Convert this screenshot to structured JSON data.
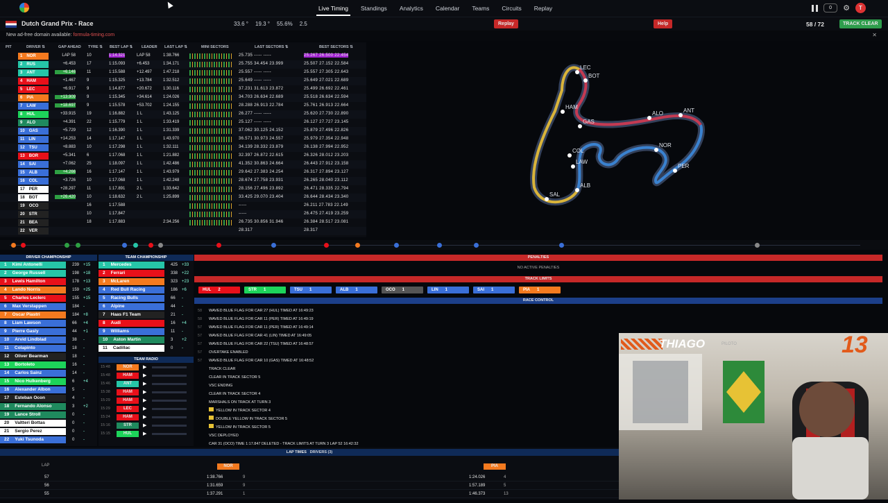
{
  "nav": {
    "items": [
      "Live Timing",
      "Standings",
      "Analytics",
      "Calendar",
      "Teams",
      "Circuits",
      "Replay"
    ],
    "active": "Live Timing",
    "notif_count": "0",
    "avatar": "T"
  },
  "race": {
    "title": "Dutch Grand Prix - Race",
    "air_temp": "33.6 °",
    "track_temp": "19.3 °",
    "humidity": "55.6%",
    "wind": "2.5",
    "replay_label": "Replay",
    "help_label": "Help",
    "lap": "58 / 72",
    "status": "TRACK CLEAR"
  },
  "ad": {
    "text": "New ad-free domain available:",
    "link": "formula-timing.com"
  },
  "timing": {
    "headers": [
      "PIT",
      "DRIVER ⇅",
      "GAP AHEAD",
      "TYRE ⇅",
      "BEST LAP ⇅",
      "LEADER",
      "LAST LAP ⇅",
      "MINI SECTORS",
      "LAST SECTORS ⇅",
      "BEST SECTORS ⇅"
    ],
    "rows": [
      {
        "p": "1",
        "d": "NOR",
        "c": "#f47a1f",
        "gap": "LAP 58",
        "ty": "10",
        "best": "1:14.321",
        "lead": "LAP 58",
        "last": "1:38.766",
        "ls": "25.735 ----- -----",
        "bs": "25.267 26.500 22.454"
      },
      {
        "p": "2",
        "d": "RUS",
        "c": "#26c6a8",
        "gap": "+6.453",
        "ty": "17",
        "best": "1:15.093",
        "lead": "+6.453",
        "last": "1:34.171",
        "ls": "25.755 34.454 23.999",
        "bs": "25.507 27.152 22.584"
      },
      {
        "p": "3",
        "d": "ANT",
        "c": "#26c6a8",
        "gap": "+6.146",
        "ty": "11",
        "best": "1:15.588",
        "lead": "+12.497",
        "last": "1:47.218",
        "ls": "25.557 ----- -----",
        "bs": "25.557 27.305 22.643"
      },
      {
        "p": "4",
        "d": "HAM",
        "c": "#e8101a",
        "gap": "+1.467",
        "ty": "9",
        "best": "1:15.325",
        "lead": "+13.784",
        "last": "1:32.512",
        "ls": "25.649 ----- -----",
        "bs": "25.649 27.021 22.689"
      },
      {
        "p": "5",
        "d": "LEC",
        "c": "#e8101a",
        "gap": "+6.917",
        "ty": "9",
        "best": "1:14.877",
        "lead": "+20.672",
        "last": "1:30.116",
        "ls": "37.231 31.613 23.872",
        "bs": "25.499 26.692 22.461"
      },
      {
        "p": "6",
        "d": "PIA",
        "c": "#f47a1f",
        "gap": "+13.909",
        "ty": "9",
        "best": "1:15.345",
        "lead": "+34.614",
        "last": "1:24.026",
        "ls": "34.703 26.634 22.689",
        "bs": "25.518 26.634 22.594"
      },
      {
        "p": "7",
        "d": "LAW",
        "c": "#3a6fd8",
        "gap": "+18.697",
        "ty": "9",
        "best": "1:15.578",
        "lead": "+53.702",
        "last": "1:24.155",
        "ls": "28.288 26.913 22.784",
        "bs": "25.761 26.913 22.664"
      },
      {
        "p": "8",
        "d": "HUL",
        "c": "#1dd45a",
        "gap": "+33.915",
        "ty": "19",
        "best": "1:16.882",
        "lead": "1 L",
        "last": "1:43.125",
        "ls": "26.277 ----- -----",
        "bs": "25.620 27.730 22.890"
      },
      {
        "p": "9",
        "d": "ALO",
        "c": "#1f8a5e",
        "gap": "+4.391",
        "ty": "22",
        "best": "1:15.779",
        "lead": "1 L",
        "last": "1:33.419",
        "ls": "25.127 ----- -----",
        "bs": "26.127 27.727 23.145"
      },
      {
        "p": "10",
        "d": "GAS",
        "c": "#3a6fd8",
        "gap": "+5.729",
        "ty": "12",
        "best": "1:16.390",
        "lead": "1 L",
        "last": "1:31.339",
        "ls": "37.062 30.125 24.152",
        "bs": "25.879 27.496 22.826"
      },
      {
        "p": "11",
        "d": "LIN",
        "c": "#3a6fd8",
        "gap": "+14.253",
        "ty": "14",
        "best": "1:17.147",
        "lead": "1 L",
        "last": "1:43.970",
        "ls": "36.571 30.973 24.557",
        "bs": "25.979 27.354 22.948"
      },
      {
        "p": "12",
        "d": "TSU",
        "c": "#3a6fd8",
        "gap": "+8.883",
        "ty": "10",
        "best": "1:17.298",
        "lead": "1 L",
        "last": "1:32.111",
        "ls": "34.139 28.332 23.879",
        "bs": "26.138 27.994 22.952"
      },
      {
        "p": "13",
        "d": "BOR",
        "c": "#e8101a",
        "gap": "+5.341",
        "ty": "6",
        "best": "1:17.068",
        "lead": "1 L",
        "last": "1:21.882",
        "ls": "32.397 26.872 22.615",
        "bs": "26.326 28.012 23.203"
      },
      {
        "p": "14",
        "d": "SAI",
        "c": "#3a6fd8",
        "gap": "+7.062",
        "ty": "25",
        "best": "1:18.097",
        "lead": "1 L",
        "last": "1:42.486",
        "ls": "41.352 30.863 24.664",
        "bs": "26.443 27.912 23.158"
      },
      {
        "p": "15",
        "d": "ALB",
        "c": "#3a6fd8",
        "gap": "+4.266",
        "ty": "16",
        "best": "1:17.147",
        "lead": "1 L",
        "last": "1:43.979",
        "ls": "29.642 27.383 24.254",
        "bs": "26.317 27.894 23.127"
      },
      {
        "p": "16",
        "d": "COL",
        "c": "#3a6fd8",
        "gap": "+3.726",
        "ty": "10",
        "best": "1:17.068",
        "lead": "1 L",
        "last": "1:42.248",
        "ls": "28.674 27.758 23.931",
        "bs": "26.265 28.040 23.112"
      },
      {
        "p": "17",
        "d": "PER",
        "c": "#ffffff",
        "gap": "+28.297",
        "ty": "11",
        "best": "1:17.891",
        "lead": "2 L",
        "last": "1:33.642",
        "ls": "28.156 27.496 23.892",
        "bs": "26.471 28.335 22.794"
      },
      {
        "p": "18",
        "d": "BOT",
        "c": "#ffffff",
        "gap": "+26.420",
        "ty": "10",
        "best": "1:18.632",
        "lead": "2 L",
        "last": "1:25.899",
        "ls": "33.425 29.070 23.404",
        "bs": "26.644 28.434 23.340"
      },
      {
        "p": "19",
        "d": "OCO",
        "c": "#222",
        "gap": "",
        "ty": "16",
        "best": "1:17.588",
        "lead": "",
        "last": "",
        "ls": "-----",
        "bs": "26.211 27.783 22.149"
      },
      {
        "p": "20",
        "d": "STR",
        "c": "#222",
        "gap": "",
        "ty": "10",
        "best": "1:17.847",
        "lead": "",
        "last": "",
        "ls": "-----",
        "bs": "26.475 27.419 23.259"
      },
      {
        "p": "21",
        "d": "BEA",
        "c": "#222",
        "gap": "",
        "ty": "18",
        "best": "1:17.883",
        "lead": "",
        "last": "2:34.256",
        "ls": "26.735 30.856 31.946",
        "bs": "26.384 28.517 23.081"
      },
      {
        "p": "22",
        "d": "VER",
        "c": "#222",
        "gap": "",
        "ty": "",
        "best": "",
        "lead": "",
        "last": "",
        "ls": "28.317",
        "bs": "28.317"
      }
    ]
  },
  "map": {
    "labels": [
      "BOT",
      "ANT",
      "ALO",
      "HAM",
      "NOR",
      "COL",
      "LAW",
      "PER",
      "ALB",
      "SAL",
      "LEC",
      "GAS"
    ]
  },
  "driver_champ": {
    "title": "DRIVER CHAMPIONSHIP",
    "rows": [
      {
        "n": "1",
        "name": "Kimi Antonelli",
        "c": "#26c6a8",
        "pts": "239",
        "d": "+15"
      },
      {
        "n": "2",
        "name": "George Russell",
        "c": "#26c6a8",
        "pts": "198",
        "d": "+18"
      },
      {
        "n": "3",
        "name": "Lewis Hamilton",
        "c": "#e8101a",
        "pts": "178",
        "d": "+13"
      },
      {
        "n": "4",
        "name": "Lando Norris",
        "c": "#f47a1f",
        "pts": "159",
        "d": "+25"
      },
      {
        "n": "5",
        "name": "Charles Leclerc",
        "c": "#e8101a",
        "pts": "155",
        "d": "+15"
      },
      {
        "n": "6",
        "name": "Max Verstappen",
        "c": "#3a6fd8",
        "pts": "184",
        "d": "-"
      },
      {
        "n": "7",
        "name": "Oscar Piastri",
        "c": "#f47a1f",
        "pts": "184",
        "d": "+8"
      },
      {
        "n": "8",
        "name": "Liam Lawson",
        "c": "#3a6fd8",
        "pts": "66",
        "d": "+4"
      },
      {
        "n": "9",
        "name": "Pierre Gasly",
        "c": "#3a6fd8",
        "pts": "44",
        "d": "+1"
      },
      {
        "n": "10",
        "name": "Arvid Lindblad",
        "c": "#3a6fd8",
        "pts": "38",
        "d": "-"
      },
      {
        "n": "11",
        "name": "Colapinto",
        "c": "#3a6fd8",
        "pts": "18",
        "d": "-"
      },
      {
        "n": "12",
        "name": "Oliver Bearman",
        "c": "#222",
        "pts": "18",
        "d": "-"
      },
      {
        "n": "13",
        "name": "Bortoleto",
        "c": "#1dd45a",
        "pts": "16",
        "d": "-"
      },
      {
        "n": "14",
        "name": "Carlos Sainz",
        "c": "#3a6fd8",
        "pts": "14",
        "d": "-"
      },
      {
        "n": "15",
        "name": "Nico Hulkenberg",
        "c": "#1dd45a",
        "pts": "6",
        "d": "+4"
      },
      {
        "n": "16",
        "name": "Alexander Albon",
        "c": "#3a6fd8",
        "pts": "5",
        "d": "-"
      },
      {
        "n": "17",
        "name": "Esteban Ocon",
        "c": "#222",
        "pts": "4",
        "d": "-"
      },
      {
        "n": "18",
        "name": "Fernando Alonso",
        "c": "#1f8a5e",
        "pts": "3",
        "d": "+2"
      },
      {
        "n": "19",
        "name": "Lance Stroll",
        "c": "#1f8a5e",
        "pts": "0",
        "d": "-"
      },
      {
        "n": "20",
        "name": "Valtteri Bottas",
        "c": "#ffffff",
        "pts": "0",
        "d": "-"
      },
      {
        "n": "21",
        "name": "Sergio Perez",
        "c": "#ffffff",
        "pts": "0",
        "d": "-"
      },
      {
        "n": "22",
        "name": "Yuki Tsunoda",
        "c": "#3a6fd8",
        "pts": "0",
        "d": "-"
      }
    ]
  },
  "team_champ": {
    "title": "TEAM CHAMPIONSHIP",
    "rows": [
      {
        "n": "1",
        "name": "Mercedes",
        "c": "#26c6a8",
        "pts": "425",
        "d": "+33"
      },
      {
        "n": "2",
        "name": "Ferrari",
        "c": "#e8101a",
        "pts": "338",
        "d": "+22"
      },
      {
        "n": "3",
        "name": "McLaren",
        "c": "#f47a1f",
        "pts": "323",
        "d": "+23"
      },
      {
        "n": "4",
        "name": "Red Bull Racing",
        "c": "#3a6fd8",
        "pts": "186",
        "d": "+6"
      },
      {
        "n": "5",
        "name": "Racing Bulls",
        "c": "#3a6fd8",
        "pts": "66",
        "d": "-"
      },
      {
        "n": "6",
        "name": "Alpine",
        "c": "#3a6fd8",
        "pts": "44",
        "d": "-"
      },
      {
        "n": "7",
        "name": "Haas F1 Team",
        "c": "#222",
        "pts": "21",
        "d": "-"
      },
      {
        "n": "8",
        "name": "Audi",
        "c": "#e8101a",
        "pts": "16",
        "d": "+4"
      },
      {
        "n": "9",
        "name": "Williams",
        "c": "#3a6fd8",
        "pts": "11",
        "d": "-"
      },
      {
        "n": "10",
        "name": "Aston Martin",
        "c": "#1f8a5e",
        "pts": "3",
        "d": "+2"
      },
      {
        "n": "11",
        "name": "Cadillac",
        "c": "#ffffff",
        "pts": "0",
        "d": "-"
      }
    ]
  },
  "team_radio": {
    "title": "TEAM RADIO",
    "rows": [
      {
        "t": "15:48",
        "d": "NOR",
        "c": "#f47a1f"
      },
      {
        "t": "15:48",
        "d": "HAM",
        "c": "#e8101a"
      },
      {
        "t": "15:46",
        "d": "ANT",
        "c": "#26c6a8"
      },
      {
        "t": "15:38",
        "d": "HAM",
        "c": "#e8101a"
      },
      {
        "t": "15:29",
        "d": "HAM",
        "c": "#e8101a"
      },
      {
        "t": "15:29",
        "d": "LEC",
        "c": "#e8101a"
      },
      {
        "t": "15:24",
        "d": "HAM",
        "c": "#e8101a"
      },
      {
        "t": "15:16",
        "d": "STR",
        "c": "#1f8a5e"
      },
      {
        "t": "15:15",
        "d": "HUL",
        "c": "#1dd45a"
      }
    ]
  },
  "penalties": {
    "title": "PENALTIES",
    "empty": "NO ACTIVE PENALTIES"
  },
  "track_limits": {
    "title": "TRACK LIMITS",
    "chips": [
      {
        "d": "HUL",
        "n": "2",
        "c": "#e8101a"
      },
      {
        "d": "STR",
        "n": "1",
        "c": "#1dd45a"
      },
      {
        "d": "TSU",
        "n": "1",
        "c": "#3a6fd8"
      },
      {
        "d": "ALB",
        "n": "1",
        "c": "#3a6fd8"
      },
      {
        "d": "OCO",
        "n": "1",
        "c": "#555"
      },
      {
        "d": "LIN",
        "n": "1",
        "c": "#3a6fd8"
      },
      {
        "d": "SAI",
        "n": "1",
        "c": "#3a6fd8"
      },
      {
        "d": "PIA",
        "n": "1",
        "c": "#f47a1f"
      }
    ]
  },
  "race_control": {
    "title": "RACE CONTROL",
    "rows": [
      {
        "l": "58",
        "t": "WAVED BLUE FLAG FOR CAR 27 (HUL) TIMED AT 16:49:23"
      },
      {
        "l": "58",
        "t": "WAVED BLUE FLAG FOR CAR 11 (PER) TIMED AT 16:49:19"
      },
      {
        "l": "57",
        "t": "WAVED BLUE FLAG FOR CAR 11 (PER) TIMED AT 16:49:14"
      },
      {
        "l": "57",
        "t": "WAVED BLUE FLAG FOR CAR 41 (LIN) TIMED AT 16:49:05"
      },
      {
        "l": "57",
        "t": "WAVED BLUE FLAG FOR CAR 22 (TSU) TIMED AT 16:48:57"
      },
      {
        "l": "57",
        "t": "OVERTAKE ENABLED"
      },
      {
        "l": "57",
        "t": "WAVED BLUE FLAG FOR CAR 10 (GAS) TIMED AT 16:48:52"
      },
      {
        "l": "",
        "t": "TRACK CLEAR"
      },
      {
        "l": "",
        "t": "CLEAR IN TRACK SECTOR 5"
      },
      {
        "l": "",
        "t": "VSC ENDING"
      },
      {
        "l": "",
        "t": "CLEAR IN TRACK SECTOR 4"
      },
      {
        "l": "",
        "t": "MARSHALS ON TRACK AT TURN 3"
      },
      {
        "l": "",
        "t": "YELLOW IN TRACK SECTOR 4"
      },
      {
        "l": "",
        "t": "DOUBLE YELLOW IN TRACK SECTOR 5"
      },
      {
        "l": "",
        "t": "YELLOW IN TRACK SECTOR 5"
      },
      {
        "l": "",
        "t": "VSC DEPLOYED"
      },
      {
        "l": "",
        "t": "CAR 31 (OCO) TIME 1:17.847 DELETED - TRACK LIMITS AT TURN 3 LAP 52 16:42:32"
      }
    ]
  },
  "lap_times": {
    "title": "LAP TIMES",
    "selector": "DRIVERS (3)",
    "col_lap": "LAP",
    "d1": "NOR",
    "d2": "PIA",
    "rows": [
      {
        "lap": "57",
        "a": "1:38.766",
        "ap": "9",
        "b": "1:24.026",
        "bp": "4"
      },
      {
        "lap": "56",
        "a": "1:31.659",
        "ap": "9",
        "b": "1:57.189",
        "bp": "5"
      },
      {
        "lap": "55",
        "a": "1:37.291",
        "ap": "1",
        "b": "1:46.373",
        "bp": "13"
      }
    ]
  },
  "webcam": {
    "name": "THIAGO",
    "role": "PILOTO",
    "number": "13"
  }
}
